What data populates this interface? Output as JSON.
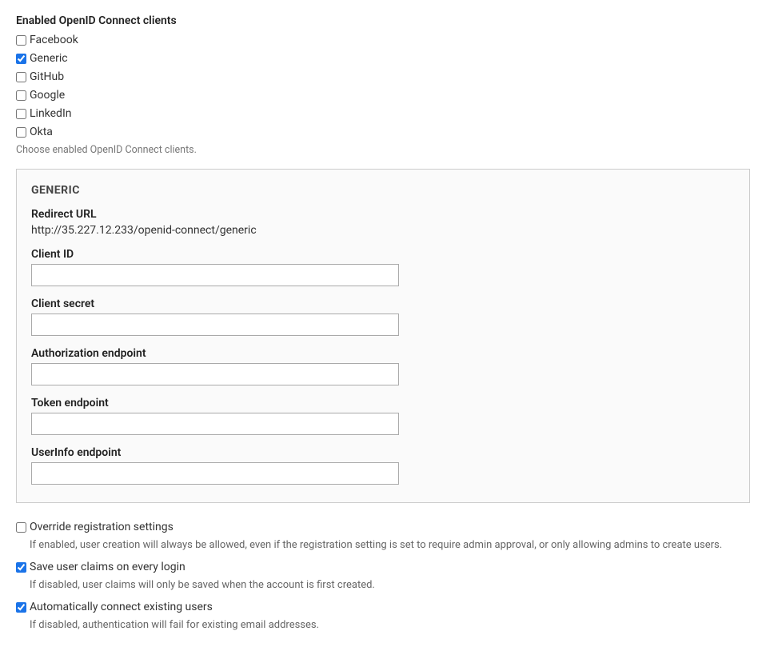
{
  "clients": {
    "title": "Enabled OpenID Connect clients",
    "items": [
      {
        "label": "Facebook",
        "checked": false
      },
      {
        "label": "Generic",
        "checked": true
      },
      {
        "label": "GitHub",
        "checked": false
      },
      {
        "label": "Google",
        "checked": false
      },
      {
        "label": "LinkedIn",
        "checked": false
      },
      {
        "label": "Okta",
        "checked": false
      }
    ],
    "help": "Choose enabled OpenID Connect clients."
  },
  "panel": {
    "title": "GENERIC",
    "redirect_label": "Redirect URL",
    "redirect_value": "http://35.227.12.233/openid-connect/generic",
    "client_id_label": "Client ID",
    "client_id_value": "",
    "client_secret_label": "Client secret",
    "client_secret_value": "",
    "auth_endpoint_label": "Authorization endpoint",
    "auth_endpoint_value": "",
    "token_endpoint_label": "Token endpoint",
    "token_endpoint_value": "",
    "userinfo_endpoint_label": "UserInfo endpoint",
    "userinfo_endpoint_value": ""
  },
  "options": {
    "override": {
      "label": "Override registration settings",
      "checked": false,
      "help": "If enabled, user creation will always be allowed, even if the registration setting is set to require admin approval, or only allowing admins to create users."
    },
    "save_claims": {
      "label": "Save user claims on every login",
      "checked": true,
      "help": "If disabled, user claims will only be saved when the account is first created."
    },
    "auto_connect": {
      "label": "Automatically connect existing users",
      "checked": true,
      "help": "If disabled, authentication will fail for existing email addresses."
    }
  }
}
